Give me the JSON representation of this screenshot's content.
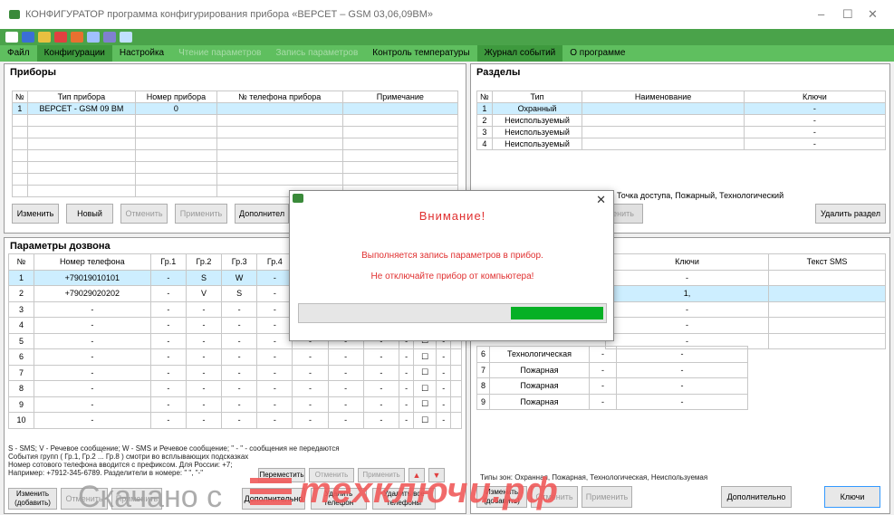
{
  "window": {
    "title": "КОНФИГУРАТОР программа конфигурирования прибора «ВЕРСЕТ – GSM 03,06,09ВМ»",
    "minimize": "–",
    "maximize": "☐",
    "close": "✕"
  },
  "menu": [
    {
      "label": "Файл",
      "state": "normal"
    },
    {
      "label": "Конфигурации",
      "state": "active"
    },
    {
      "label": "Настройка",
      "state": "normal"
    },
    {
      "label": "Чтение параметров",
      "state": "disabled"
    },
    {
      "label": "Запись параметров",
      "state": "disabled"
    },
    {
      "label": "Контроль температуры",
      "state": "normal"
    },
    {
      "label": "Журнал событий",
      "state": "active"
    },
    {
      "label": "О программе",
      "state": "normal"
    }
  ],
  "devices": {
    "title": "Приборы",
    "headers": [
      "№",
      "Тип прибора",
      "Номер прибора",
      "№ телефона прибора",
      "Примечание"
    ],
    "rows": [
      [
        "1",
        "ВЕРСЕТ - GSM 09 ВМ",
        "0",
        "",
        ""
      ]
    ],
    "buttons": {
      "edit": "Изменить",
      "new": "Новый",
      "cancel": "Отменить",
      "apply": "Применить",
      "more": "Дополнител"
    }
  },
  "sections": {
    "title": "Разделы",
    "headers": [
      "№",
      "Тип",
      "Наименование",
      "Ключи"
    ],
    "rows": [
      [
        "1",
        "Охранный",
        "",
        "-"
      ],
      [
        "2",
        "Неиспользуемый",
        "",
        "-"
      ],
      [
        "3",
        "Неиспользуемый",
        "",
        "-"
      ],
      [
        "4",
        "Неиспользуемый",
        "",
        "-"
      ]
    ],
    "types_note": ": Точка доступа, Пожарный, Технологический",
    "apply_partial": "менить",
    "delete": "Удалить раздел"
  },
  "dial": {
    "title": "Параметры дозвона",
    "headers": [
      "№",
      "Номер телефона",
      "Гр.1",
      "Гр.2",
      "Гр.3",
      "Гр.4",
      "Гр.5",
      "Гр.6",
      "Гр.7"
    ],
    "rows": [
      [
        "1",
        "+79019010101",
        "-",
        "S",
        "W",
        "-",
        "-",
        "-",
        "-"
      ],
      [
        "2",
        "+79029020202",
        "-",
        "V",
        "S",
        "-",
        "-",
        "-",
        "-"
      ],
      [
        "3",
        "-",
        "-",
        "-",
        "-",
        "-",
        "-",
        "-",
        "-"
      ],
      [
        "4",
        "-",
        "-",
        "-",
        "-",
        "-",
        "-",
        "-",
        "-"
      ],
      [
        "5",
        "-",
        "-",
        "-",
        "-",
        "-",
        "-",
        "-",
        "-"
      ],
      [
        "6",
        "-",
        "-",
        "-",
        "-",
        "-",
        "-",
        "-",
        "-"
      ],
      [
        "7",
        "-",
        "-",
        "-",
        "-",
        "-",
        "-",
        "-",
        "-"
      ],
      [
        "8",
        "-",
        "-",
        "-",
        "-",
        "-",
        "-",
        "-",
        "-"
      ],
      [
        "9",
        "-",
        "-",
        "-",
        "-",
        "-",
        "-",
        "-",
        "-"
      ],
      [
        "10",
        "-",
        "-",
        "-",
        "-",
        "-",
        "-",
        "-",
        "-"
      ]
    ],
    "extra_dash": "-",
    "checkbox": "☐"
  },
  "zones": {
    "headers": [
      "Ключи",
      "Текст SMS"
    ],
    "row1_key": "1,",
    "rows": [
      [
        "6",
        "Технологическая",
        "-",
        "-"
      ],
      [
        "7",
        "Пожарная",
        "-",
        "-"
      ],
      [
        "8",
        "Пожарная",
        "-",
        "-"
      ],
      [
        "9",
        "Пожарная",
        "-",
        "-"
      ]
    ],
    "dash": "-",
    "types_note": "Типы зон: Охранная, Пожарная, Технологическая, Неиспользуемая"
  },
  "notes": {
    "l1": "S - SMS;  V - Речевое сообщение;  W - SMS и Речевое сообщение; \" - \" - сообщения не передаются",
    "l2": "События групп ( Гр.1, Гр.2 ... Гр.8 ) смотри во всплывающих подсказках",
    "l3": "Номер сотового телефона вводится с префиксом. Для России: +7;",
    "l4": "Например: +7912-345-6789. Разделители в номере: \" \", \"-\""
  },
  "bottom_buttons": {
    "edit_add": "Изменить (добавить)",
    "cancel": "Отменить",
    "apply": "Применить",
    "move": "Переместить",
    "cancel2": "Отменить",
    "apply2": "Применить",
    "more": "Дополнительно",
    "del_phone": "Удалить телефон",
    "del_all": "Удалить все телефоны",
    "edit_add2": "Изменить (добавить)",
    "cancel3": "Отменить",
    "apply3": "Применить",
    "more2": "Дополнительно",
    "keys": "Ключи"
  },
  "modal": {
    "heading": "Внимание!",
    "line1": "Выполняется запись параметров в прибор.",
    "line2": "Не отключайте прибор от компьютера!",
    "close": "✕",
    "progress": 0.3
  },
  "watermark": {
    "prefix": "Скачано с",
    "brand": "техключи.рф"
  },
  "colors": {
    "menubar": "#5fbf5f",
    "toolbar": "#4aa34a",
    "warning": "#e03030",
    "progress": "#06b025",
    "selection": "#cdeeff"
  }
}
